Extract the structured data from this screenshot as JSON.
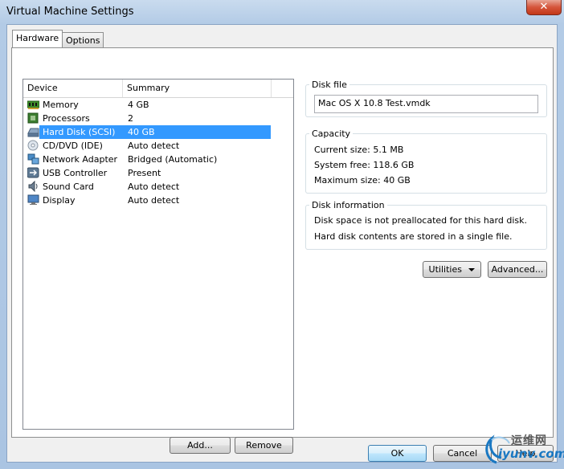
{
  "window": {
    "title": "Virtual Machine Settings",
    "close_label": "✕"
  },
  "tabs": [
    {
      "label": "Hardware"
    },
    {
      "label": "Options"
    }
  ],
  "device_list": {
    "headers": {
      "device": "Device",
      "summary": "Summary"
    },
    "rows": [
      {
        "name": "Memory",
        "summary": "4 GB",
        "icon": "memory-icon"
      },
      {
        "name": "Processors",
        "summary": "2",
        "icon": "processor-icon"
      },
      {
        "name": "Hard Disk (SCSI)",
        "summary": "40 GB",
        "icon": "hard-disk-icon",
        "selected": true
      },
      {
        "name": "CD/DVD (IDE)",
        "summary": "Auto detect",
        "icon": "cd-dvd-icon"
      },
      {
        "name": "Network Adapter",
        "summary": "Bridged (Automatic)",
        "icon": "network-adapter-icon"
      },
      {
        "name": "USB Controller",
        "summary": "Present",
        "icon": "usb-icon"
      },
      {
        "name": "Sound Card",
        "summary": "Auto detect",
        "icon": "sound-card-icon"
      },
      {
        "name": "Display",
        "summary": "Auto detect",
        "icon": "display-icon"
      }
    ]
  },
  "buttons": {
    "add": "Add...",
    "remove": "Remove",
    "utilities": "Utilities",
    "advanced": "Advanced...",
    "ok": "OK",
    "cancel": "Cancel",
    "help": "Help"
  },
  "disk_file": {
    "label": "Disk file",
    "value": "Mac OS X 10.8 Test.vmdk"
  },
  "capacity": {
    "label": "Capacity",
    "current_size": "Current size:  5.1 MB",
    "system_free": "System free:  118.6 GB",
    "maximum_size": "Maximum size:  40 GB"
  },
  "disk_information": {
    "label": "Disk information",
    "line1": "Disk space is not preallocated for this hard disk.",
    "line2": "Hard disk contents are stored in a single file."
  },
  "watermark": {
    "line1": "运维网",
    "line2": "iyunv.com"
  },
  "colors": {
    "selection": "#3399ff",
    "title_bar": "#b9d1ea",
    "close_button": "#c9462c"
  }
}
